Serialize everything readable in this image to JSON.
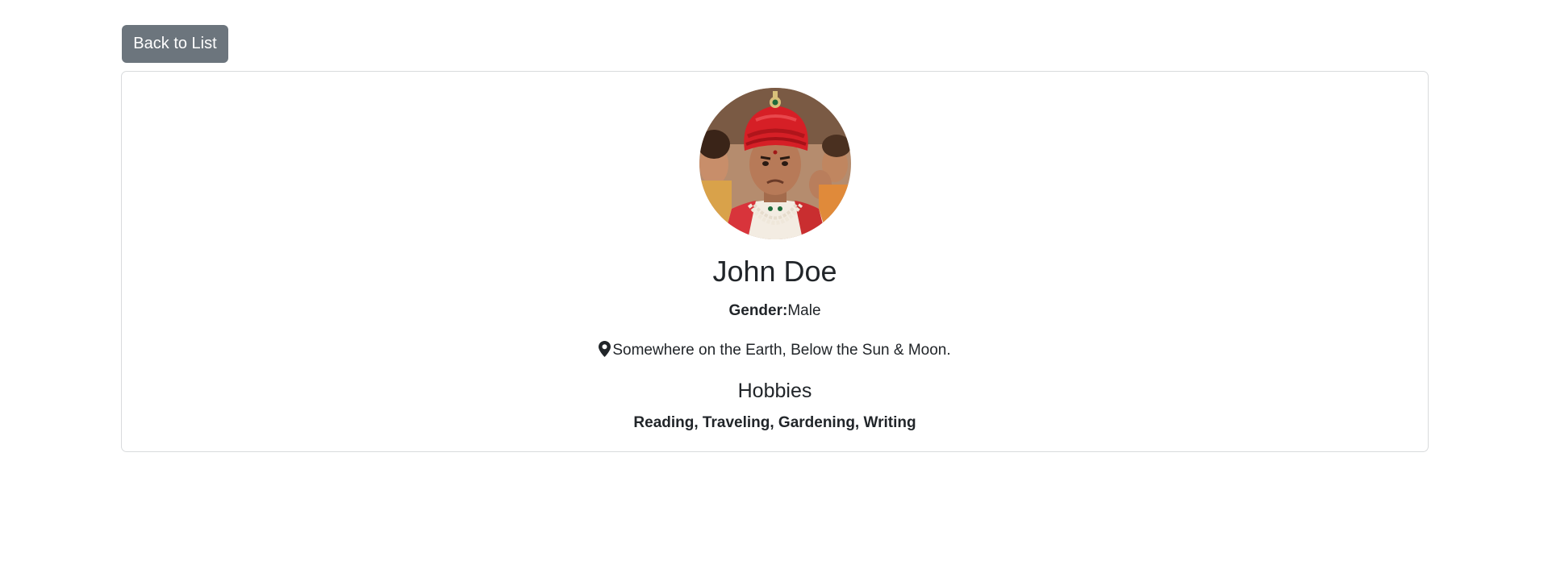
{
  "toolbar": {
    "back_label": "Back to List"
  },
  "profile": {
    "avatar_alt": "Profile photo",
    "name": "John Doe",
    "gender_label": "Gender:",
    "gender_value": "Male",
    "location_icon": "map-pin-icon",
    "location": "Somewhere on the Earth, Below the Sun & Moon.",
    "hobbies_heading": "Hobbies",
    "hobbies": "Reading, Traveling, Gardening, Writing"
  },
  "colors": {
    "button_bg": "#6c757d",
    "button_text": "#ffffff",
    "card_border": "#d9dbdd",
    "text": "#212529"
  }
}
